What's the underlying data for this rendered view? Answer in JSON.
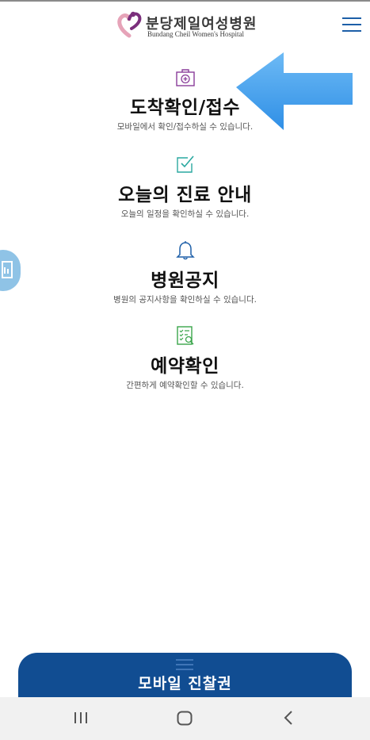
{
  "header": {
    "logo_ko": "분당제일여성병원",
    "logo_en": "Bundang Cheil Women's Hospital"
  },
  "menu_items": [
    {
      "title": "도착확인/접수",
      "desc": "모바일에서 확인/접수하실 수 있습니다.",
      "icon": "medical-kit-icon"
    },
    {
      "title": "오늘의 진료 안내",
      "desc": "오늘의 일정을 확인하실 수 있습니다.",
      "icon": "checkbox-icon"
    },
    {
      "title": "병원공지",
      "desc": "병원의 공지사항을 확인하실 수 있습니다.",
      "icon": "bell-icon"
    },
    {
      "title": "예약확인",
      "desc": "간편하게 예약확인할 수 있습니다.",
      "icon": "checklist-icon"
    }
  ],
  "bottom_button": {
    "label": "모바일 진찰권"
  },
  "colors": {
    "accent": "#114d92",
    "arrow": "#4aa3ee",
    "icon_purple": "#8a3d9a",
    "icon_teal": "#2aa8a0",
    "icon_blue": "#1d5fa8",
    "icon_green": "#3aa54a"
  },
  "nav": {
    "recent": "recent-apps-icon",
    "home": "home-icon",
    "back": "back-icon"
  }
}
